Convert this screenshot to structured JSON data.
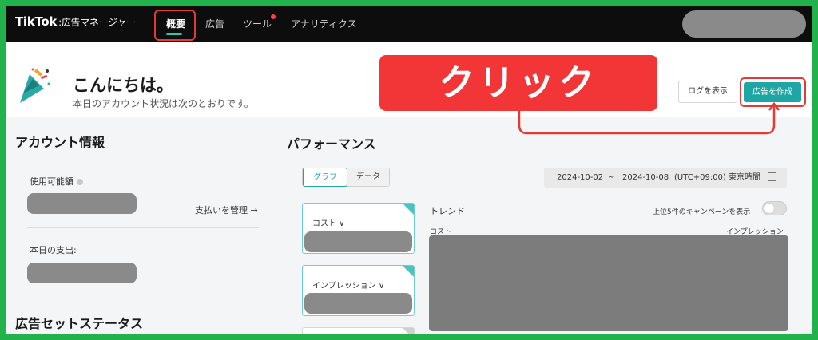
{
  "nav": {
    "brand": "TikTok",
    "brand_sub": ":広告マネージャー",
    "tabs": [
      "概要",
      "広告",
      "ツール",
      "アナリティクス"
    ]
  },
  "greeting": {
    "title": "こんにちは。",
    "subtitle": "本日のアカウント状況は次のとおりです。"
  },
  "callout": {
    "text": "クリック"
  },
  "header_buttons": {
    "log": "ログを表示",
    "create": "広告を作成"
  },
  "account": {
    "title": "アカウント情報",
    "available_label": "使用可能額",
    "manage_payment": "支払いを管理 →",
    "today_spend_label": "本日の支出:"
  },
  "adset_status": {
    "title": "広告セットステータス"
  },
  "performance": {
    "title": "パフォーマンス",
    "toggle": [
      "グラフ",
      "データ"
    ],
    "date_from": "2024-10-02",
    "date_sep": "~",
    "date_to": "2024-10-08",
    "timezone": "(UTC+09:00) 東京時間",
    "metrics": [
      "コスト ∨",
      "インプレッション ∨"
    ],
    "trend_label": "トレンド",
    "top5_label": "上位5件のキャンペーンを表示",
    "axis_left": "コスト",
    "axis_right": "インプレッション"
  },
  "colors": {
    "border_green": "#22b24c",
    "accent_teal": "#1fa5a3",
    "highlight_red": "#e53935",
    "callout_red": "#f23637"
  }
}
